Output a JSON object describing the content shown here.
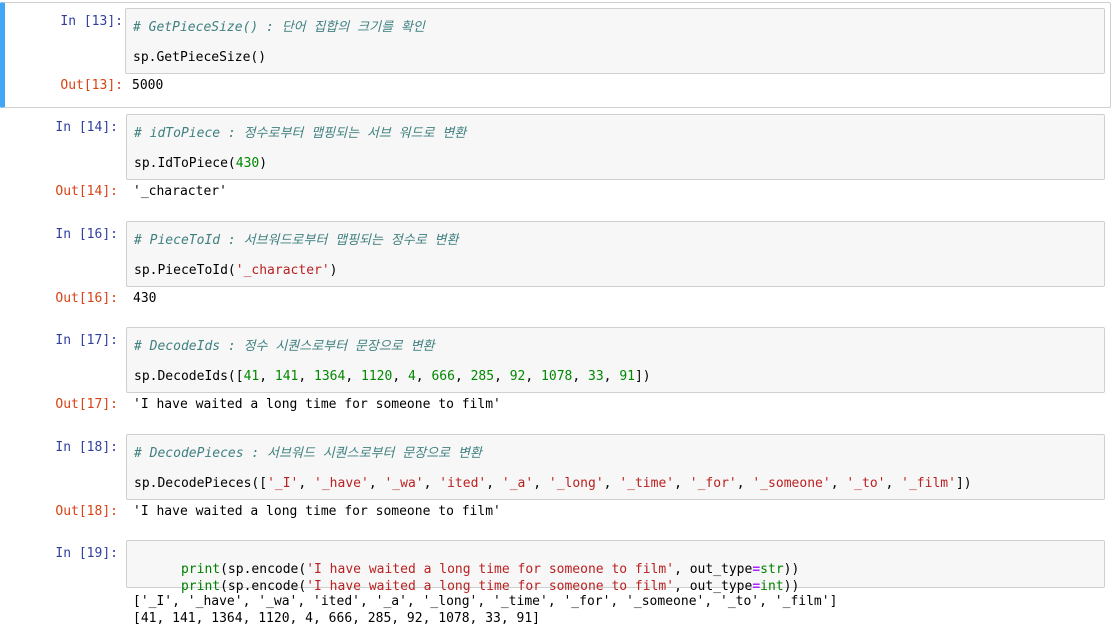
{
  "cells": [
    {
      "in_prompt": "In [13]:",
      "comment": "# GetPieceSize() : 단어 집합의 크기를 확인",
      "code": "sp.GetPieceSize()",
      "out_prompt": "Out[13]:",
      "output": "5000"
    },
    {
      "in_prompt": "In [14]:",
      "comment": "# idToPiece : 정수로부터 맵핑되는 서브 워드로 변환",
      "code_prefix": "sp.IdToPiece(",
      "code_arg": "430",
      "code_suffix": ")",
      "out_prompt": "Out[14]:",
      "output": "'_character'"
    },
    {
      "in_prompt": "In [16]:",
      "comment": "# PieceToId : 서브워드로부터 맵핑되는 정수로 변환",
      "code_prefix": "sp.PieceToId(",
      "code_arg": "'_character'",
      "code_suffix": ")",
      "out_prompt": "Out[16]:",
      "output": "430"
    },
    {
      "in_prompt": "In [17]:",
      "comment": "# DecodeIds : 정수 시퀀스로부터 문장으로 변환",
      "code_prefix": "sp.DecodeIds([",
      "code_args": [
        "41",
        "141",
        "1364",
        "1120",
        "4",
        "666",
        "285",
        "92",
        "1078",
        "33",
        "91"
      ],
      "code_suffix": "])",
      "out_prompt": "Out[17]:",
      "output": "'I have waited a long time for someone to film'"
    },
    {
      "in_prompt": "In [18]:",
      "comment": "# DecodePieces : 서브워드 시퀀스로부터 문장으로 변환",
      "code_prefix": "sp.DecodePieces([",
      "code_args": [
        "'_I'",
        "'_have'",
        "'_wa'",
        "'ited'",
        "'_a'",
        "'_long'",
        "'_time'",
        "'_for'",
        "'_someone'",
        "'_to'",
        "'_film'"
      ],
      "code_suffix": "])",
      "out_prompt": "Out[18]:",
      "output": "'I have waited a long time for someone to film'"
    },
    {
      "in_prompt": "In [19]:",
      "lines": [
        {
          "fn": "print",
          "open": "(sp.encode(",
          "str": "'I have waited a long time for someone to film'",
          "mid": ", out_type",
          "eq": "=",
          "type": "str",
          "close": "))"
        },
        {
          "fn": "print",
          "open": "(sp.encode(",
          "str": "'I have waited a long time for someone to film'",
          "mid": ", out_type",
          "eq": "=",
          "type": "int",
          "close": "))"
        }
      ],
      "output_lines": [
        "['_I', '_have', '_wa', 'ited', '_a', '_long', '_time', '_for', '_someone', '_to', '_film']",
        "[41, 141, 1364, 1120, 4, 666, 285, 92, 1078, 33, 91]"
      ]
    }
  ]
}
